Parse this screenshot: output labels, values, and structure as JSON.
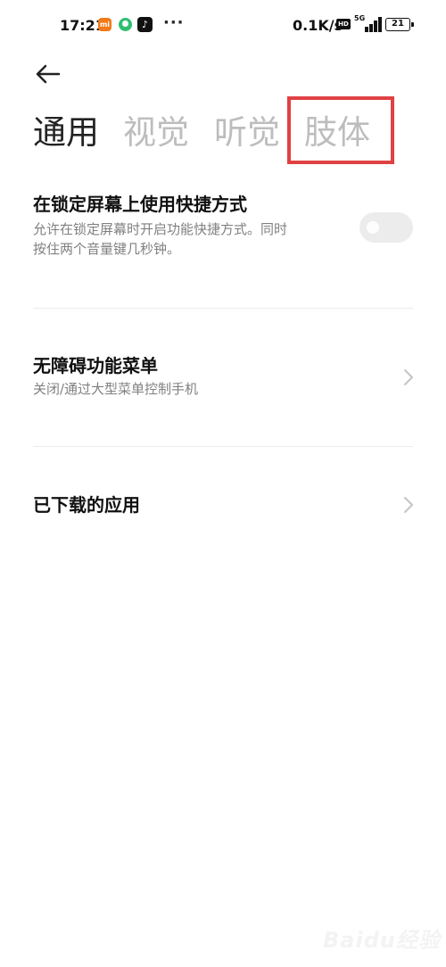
{
  "status_bar": {
    "time": "17:21",
    "mi_badge": "mi",
    "more": "···",
    "net_speed": "0.1K/s",
    "hd": "HD",
    "network": "5G",
    "battery": "21"
  },
  "nav": {
    "back_icon": "arrow-left-icon"
  },
  "tabs": [
    {
      "label": "通用",
      "active": true
    },
    {
      "label": "视觉",
      "active": false
    },
    {
      "label": "听觉",
      "active": false
    },
    {
      "label": "肢体",
      "active": false
    }
  ],
  "highlight_color": "#e04143",
  "settings": {
    "lock_shortcut": {
      "title": "在锁定屏幕上使用快捷方式",
      "desc_line1": "允许在锁定屏幕时开启功能快捷方式。同时",
      "desc_line2": "按住两个音量键几秒钟。",
      "enabled": false
    },
    "accessibility_menu": {
      "title": "无障碍功能菜单",
      "desc": "关闭/通过大型菜单控制手机"
    },
    "downloaded_apps": {
      "title": "已下载的应用"
    }
  },
  "watermark": "Baidu经验"
}
